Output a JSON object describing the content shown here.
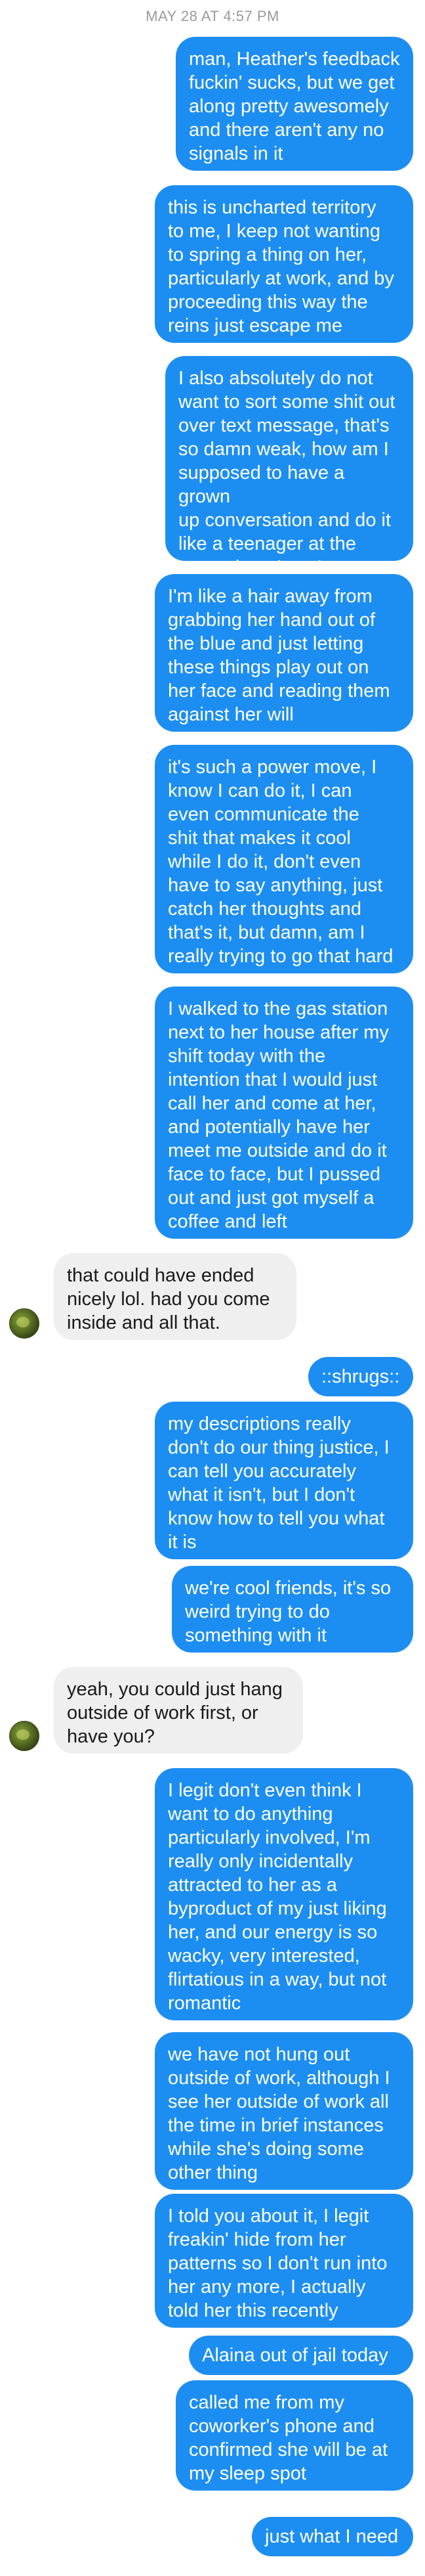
{
  "thread": {
    "timestamp": "MAY 28 AT 4:57 PM",
    "messages": [
      {
        "from": "me",
        "text": "man, Heather's feedback\nfuckin' sucks, but we get\nalong pretty awesomely\nand there aren't any no\nsignals in it"
      },
      {
        "from": "me",
        "text": "this is uncharted territory\nto me, I keep not wanting\nto spring a thing on her,\nparticularly at work, and by\nproceeding this way the\nreins just escape me"
      },
      {
        "from": "me",
        "text": "I also absolutely do not\nwant to sort some shit out\nover text message, that's\nso damn weak, how am I\nsupposed to have a grown\nup conversation and do it\nlike a teenager at the\nsame time, I can't even"
      },
      {
        "from": "me",
        "text": "I'm like a hair away from\ngrabbing her hand out of\nthe blue and just letting\nthese things play out on\nher face and reading them\nagainst her will"
      },
      {
        "from": "me",
        "text": "it's such a power move, I\nknow I can do it, I can\neven communicate the\nshit that makes it cool\nwhile I do it, don't even\nhave to say anything, just\ncatch her thoughts and\nthat's it, but damn, am I\nreally trying to go that hard"
      },
      {
        "from": "me",
        "text": "I walked to the gas station\nnext to her house after my\nshift today with the\nintention that I would just\ncall her and come at her,\nand potentially have her\nmeet me outside and do it\nface to face, but I pussed\nout and just got myself a\ncoffee and left"
      },
      {
        "from": "them",
        "text": "that could have ended\nnicely lol. had you come\ninside and all that."
      },
      {
        "from": "me",
        "text": "::shrugs::"
      },
      {
        "from": "me",
        "text": "my descriptions really\ndon't do our thing justice, I\ncan tell you accurately\nwhat it isn't, but I don't\nknow how to tell you what\nit is"
      },
      {
        "from": "me",
        "text": "we're cool friends, it's so\nweird trying to do\nsomething with it"
      },
      {
        "from": "them",
        "text": "yeah, you could just hang\noutside of work first, or\nhave you?"
      },
      {
        "from": "me",
        "text": "I legit don't even think I\nwant to do anything\nparticularly involved, I'm\nreally only incidentally\nattracted to her as a\nbyproduct of my just liking\nher, and our energy is so\nwacky, very interested,\nflirtatious in a way, but not\nromantic"
      },
      {
        "from": "me",
        "text": "we have not hung out\noutside of work, although I\nsee her outside of work all\nthe time in brief instances\nwhile she's doing some\nother thing"
      },
      {
        "from": "me",
        "text": "I told you about it, I legit\nfreakin' hide from her\npatterns so I don't run into\nher any more, I actually\ntold her this recently"
      },
      {
        "from": "me",
        "text": "Alaina out of jail today"
      },
      {
        "from": "me",
        "text": "called me from my\ncoworker's phone and\nconfirmed she will be at\nmy sleep spot"
      },
      {
        "from": "me",
        "text": "just what I need"
      }
    ]
  },
  "colors": {
    "sent_bubble": "#1d8ef1",
    "received_bubble": "#efefef",
    "timestamp": "#9a9a9a"
  }
}
